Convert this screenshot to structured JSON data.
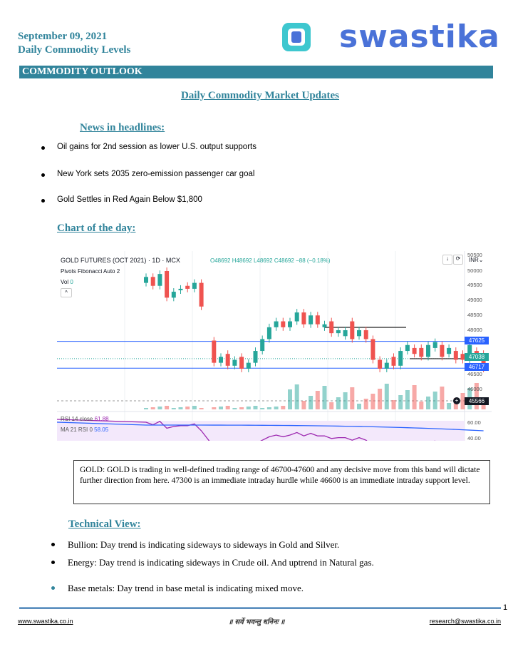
{
  "header": {
    "date": "September 09, 2021",
    "subtitle": "Daily Commodity Levels",
    "logo_text": "swastika",
    "banner": "COMMODITY OUTLOOK",
    "page_title": "Daily Commodity Market Updates"
  },
  "news": {
    "heading": "News in headlines:",
    "items": [
      "Oil gains for 2nd session as lower U.S. output supports",
      "New York sets 2035 zero-emission passenger car goal",
      "Gold Settles in Red Again Below $1,800"
    ]
  },
  "chart_section": {
    "heading": "Chart of the day:",
    "symbol": "GOLD FUTURES (OCT 2021) · 1D · MCX",
    "ohlc": "O48692 H48692 L48692 C48692 −88 (−0.18%)",
    "pivots": "Pivots Fibonacci Auto 2",
    "vol_label": "Vol",
    "vol_value": "0",
    "currency": "INR",
    "price_ticks": [
      "50500",
      "50000",
      "49500",
      "49000",
      "48500",
      "48000",
      "47500",
      "46500",
      "46000"
    ],
    "price_labels": {
      "upper": "47625",
      "last": "47038",
      "lower": "46717",
      "crosshair": "45566"
    },
    "rsi_label": "RSI 14 close",
    "rsi_value": "61.88",
    "ma_label": "MA 21 RSI 0",
    "ma_value": "58.05",
    "rsi_ticks": [
      "60.00",
      "40.00"
    ],
    "colors": {
      "up": "#26a69a",
      "down": "#ef5350",
      "rsi": "#9c27b0",
      "ma": "#2962ff",
      "level": "#2962ff"
    },
    "candles": [
      [
        49600,
        49800
      ],
      [
        49800,
        49500
      ],
      [
        49500,
        49900
      ],
      [
        50000,
        49100
      ],
      [
        49100,
        49300
      ],
      [
        49350,
        49400
      ],
      [
        49500,
        49400
      ],
      [
        49400,
        49600
      ],
      [
        49600,
        48800
      ],
      [
        47650,
        46900
      ],
      [
        46900,
        47100
      ],
      [
        47200,
        46800
      ],
      [
        46800,
        47000
      ],
      [
        47100,
        46700
      ],
      [
        46700,
        46900
      ],
      [
        46900,
        47300
      ],
      [
        47300,
        47700
      ],
      [
        47700,
        48100
      ],
      [
        48100,
        48300
      ],
      [
        48300,
        48100
      ],
      [
        48100,
        48300
      ],
      [
        48300,
        48600
      ],
      [
        48600,
        48200
      ],
      [
        48200,
        48500
      ],
      [
        48500,
        48200
      ],
      [
        48100,
        48200
      ],
      [
        48300,
        47900
      ],
      [
        47900,
        48000
      ],
      [
        47800,
        48000
      ],
      [
        48300,
        47700
      ],
      [
        47800,
        48000
      ],
      [
        48000,
        47700
      ],
      [
        47700,
        47000
      ],
      [
        47000,
        46700
      ],
      [
        46700,
        46900
      ],
      [
        47100,
        46800
      ],
      [
        46800,
        47300
      ],
      [
        47300,
        47500
      ],
      [
        47400,
        47200
      ],
      [
        47400,
        47100
      ],
      [
        47100,
        47500
      ],
      [
        47400,
        47600
      ],
      [
        47500,
        47100
      ],
      [
        47200,
        47400
      ],
      [
        47300,
        47000
      ],
      [
        47200,
        47000
      ],
      [
        47000,
        47500
      ],
      [
        47300,
        47200
      ],
      [
        47200,
        46700
      ]
    ]
  },
  "commentary": "GOLD: GOLD is trading in well-defined trading range of 46700-47600 and any decisive move from this band will dictate further direction from here. 47300 is an immediate intraday hurdle while 46600 is an immediate intraday support level.",
  "technical": {
    "heading": "Technical View:",
    "items": [
      "Bullion: Day trend is indicating sideways to sideways in Gold and Silver.",
      "Energy: Day trend is indicating sideways in Crude oil. And uptrend in Natural gas.",
      "Base metals: Day trend in base metal is indicating mixed move."
    ]
  },
  "footer": {
    "page_number": "1",
    "website": "www.swastika.co.in",
    "motto": "॥ सर्वे भवन्तु धनिनः ॥",
    "email": "research@swastika.co.in"
  }
}
